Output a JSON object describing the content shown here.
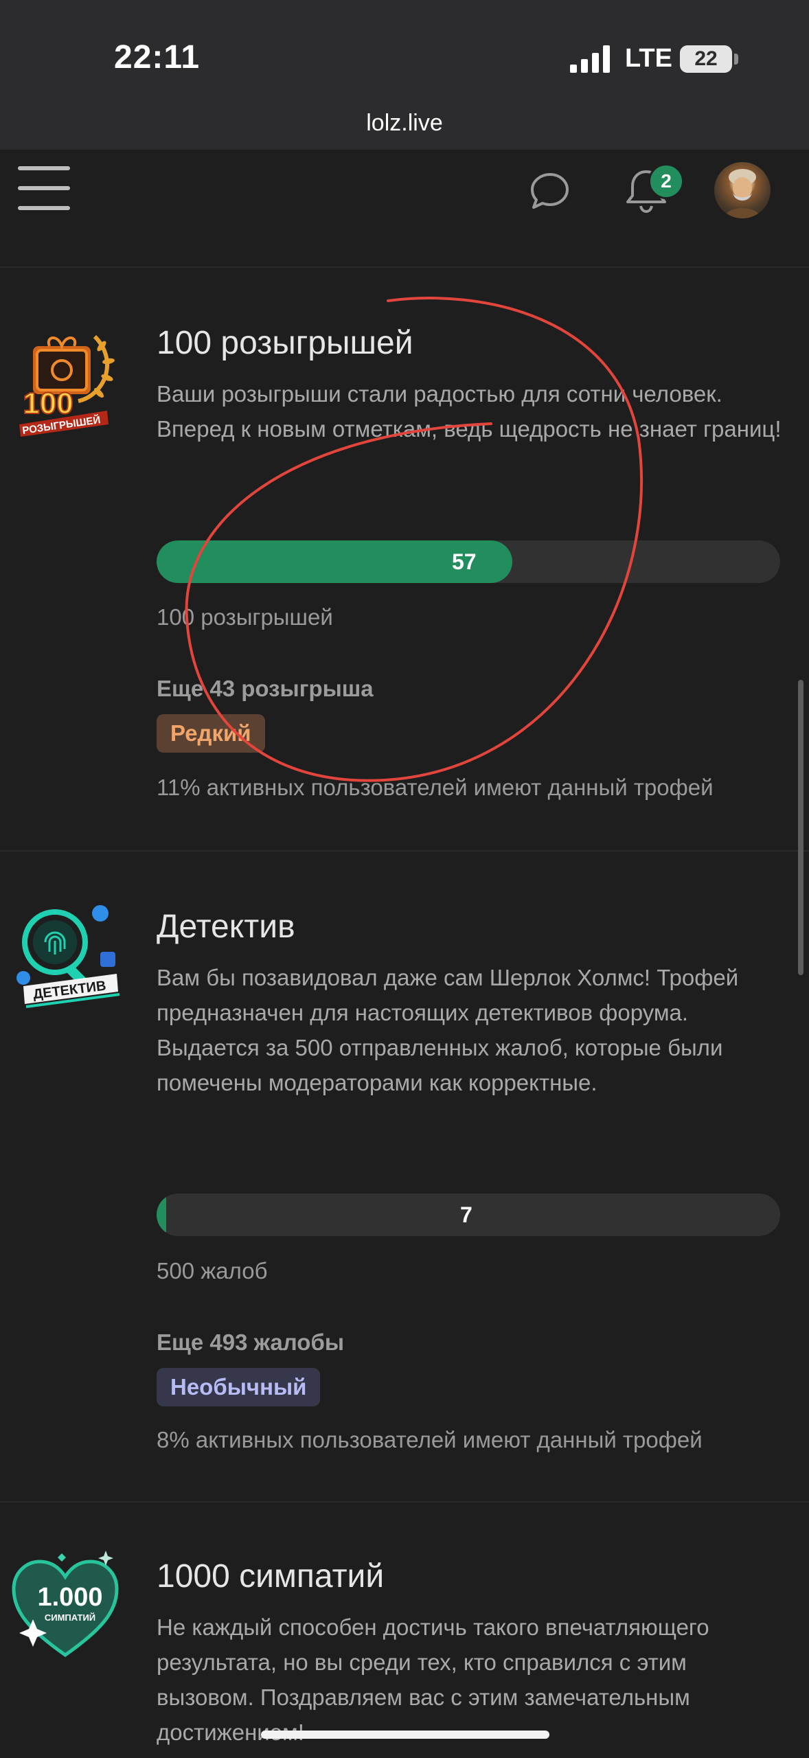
{
  "status_bar": {
    "time": "22:11",
    "network": "LTE",
    "battery": "22"
  },
  "browser": {
    "url": "lolz.live"
  },
  "header": {
    "notifications_count": "2"
  },
  "trophies": [
    {
      "title": "100 розыгрышей",
      "description": "Ваши розыгрыши стали радостью для сотни человек. Вперед к новым отметкам, ведь щедрость не знает границ!",
      "progress_value": "57",
      "progress_fraction": 0.57,
      "goal": "100 розыгрышей",
      "remaining": "Еще 43 розыгрыша",
      "rarity": "Редкий",
      "rarity_color": "#f1a56b",
      "stat": "11% активных пользователей имеют данный трофей",
      "icon_text": "100",
      "icon_subtext": "РОЗЫГРЫШЕЙ",
      "icon": "gift-laurel-icon"
    },
    {
      "title": "Детектив",
      "description": "Вам бы позавидовал даже сам Шерлок Холмс! Трофей предназначен для настоящих детективов форума. Выдается за 500 отправленных жалоб, которые были помечены модераторами как корректные.",
      "progress_value": "7",
      "progress_fraction": 0.014,
      "goal": "500 жалоб",
      "remaining": "Еще 493 жалобы",
      "rarity": "Необычный",
      "rarity_color": "#b8bcf5",
      "stat": "8% активных пользователей имеют данный трофей",
      "icon_text": "ДЕТЕКТИВ",
      "icon": "magnifier-fingerprint-icon"
    },
    {
      "title": "1000 симпатий",
      "description": "Не каждый способен достичь такого впечатляющего результата, но вы среди тех, кто справился с этим вызовом. Поздравляем вас с этим замечательным достижением!",
      "icon_text": "1.000",
      "icon_subtext": "СИМПАТИЙ",
      "icon": "heart-icon"
    }
  ],
  "colors": {
    "accent": "#228e5d",
    "annotation": "#e2453c"
  }
}
